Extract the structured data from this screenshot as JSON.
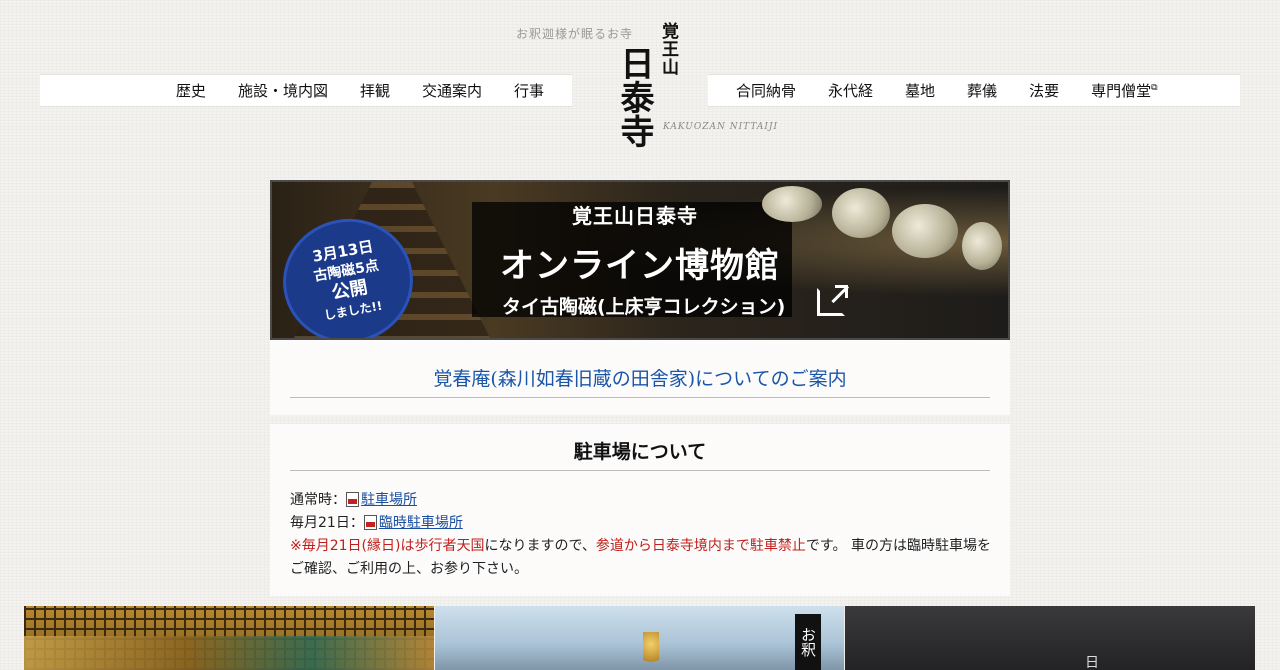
{
  "header": {
    "tagline": "お釈迦様が眠るお寺",
    "logo": {
      "mountain": "覚王山",
      "temple": "日泰寺",
      "romanized": "KAKUOZAN NITTAIJI"
    }
  },
  "nav_left": [
    {
      "label": "歴史"
    },
    {
      "label": "施設・境内図"
    },
    {
      "label": "拝観"
    },
    {
      "label": "交通案内"
    },
    {
      "label": "行事"
    }
  ],
  "nav_right": [
    {
      "label": "合同納骨"
    },
    {
      "label": "永代経"
    },
    {
      "label": "墓地"
    },
    {
      "label": "葬儀"
    },
    {
      "label": "法要"
    },
    {
      "label": "専門僧堂",
      "icon": "external-link-icon"
    }
  ],
  "banner": {
    "title": "覚王山日泰寺",
    "main": "オンライン博物館",
    "sub": "タイ古陶磁(上床亨コレクション)",
    "badge": [
      "3月13日",
      "古陶磁5点",
      "公開",
      "しました!!"
    ],
    "colors": {
      "badge": "#1c3a8a"
    }
  },
  "notice": {
    "heading": "覚春庵(森川如春旧蔵の田舎家)についてのご案内"
  },
  "parking": {
    "heading": "駐車場について",
    "regular_label": "通常時：",
    "regular_link": "駐車場所",
    "monthly_label": "毎月21日：",
    "monthly_link": "臨時駐車場所",
    "warning_red1": "※毎月21日(縁日)は歩行者天国",
    "warning_mid": "になりますので、",
    "warning_red2": "参道から日泰寺境内まで駐車禁止",
    "warning_end": "です。 車の方は臨時駐車場をご確認、ご利用の上、お参り下さい。"
  },
  "photos": {
    "photo2_text": "お釈",
    "photo3_text": "日"
  }
}
